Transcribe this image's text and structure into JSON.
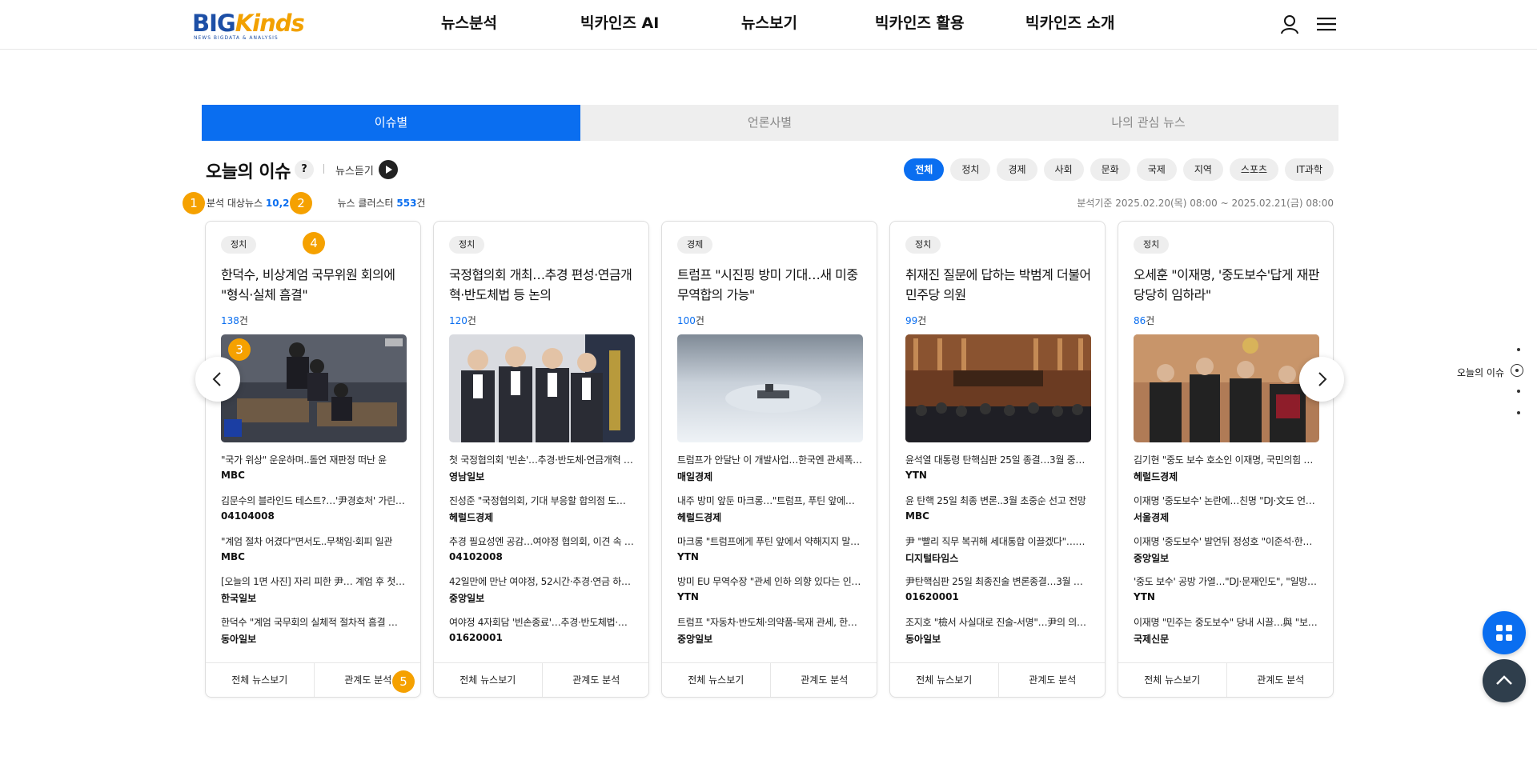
{
  "header": {
    "logo_main_big": "BIG",
    "logo_main_kinds": "Kinds",
    "logo_sub": "NEWS BIGDATA & ANALYSIS",
    "nav": [
      "뉴스분석",
      "빅카인즈 AI",
      "뉴스보기",
      "빅카인즈 활용",
      "빅카인즈 소개"
    ],
    "icons": [
      "user-icon",
      "menu-icon"
    ]
  },
  "tabs": [
    {
      "label": "이슈별",
      "active": true
    },
    {
      "label": "언론사별",
      "active": false
    },
    {
      "label": "나의 관심 뉴스",
      "active": false
    }
  ],
  "issue": {
    "title": "오늘의 이슈",
    "help": "?",
    "listen_label": "뉴스듣기",
    "categories": [
      "전체",
      "정치",
      "경제",
      "사회",
      "문화",
      "국제",
      "지역",
      "스포츠",
      "IT과학"
    ],
    "active_category": "전체",
    "stats": {
      "target_label": "분석 대상뉴스",
      "target_value": "10,21",
      "cluster_label": "뉴스 클러스터",
      "cluster_value": "553",
      "cluster_unit": "건"
    },
    "basis": "분석기준 2025.02.20(목) 08:00 ~ 2025.02.21(금) 08:00"
  },
  "markers": [
    "1",
    "2",
    "3",
    "4",
    "5"
  ],
  "cards": [
    {
      "category": "정치",
      "title": "한덕수, 비상계엄 국무위원 회의에 \"형식·실체 흠결\"",
      "count": "138",
      "unit": "건",
      "image": "courtroom-broadcast-photo",
      "news": [
        {
          "headline": "\"국가 위상\" 운운하며..돌연 재판정 떠난 윤",
          "source": "MBC"
        },
        {
          "headline": "김문수의 블라인드 테스트?…'尹경호처' 가린…",
          "source": "04104008"
        },
        {
          "headline": "\"계엄 절차 어겼다\"면서도..무책임·회피 일관",
          "source": "MBC"
        },
        {
          "headline": "[오늘의 1면 사진] 자리 피한 尹… 계엄 후 첫 …",
          "source": "한국일보"
        },
        {
          "headline": "한덕수 \"계엄 국무회의 실체적 절차적 흠결 …",
          "source": "동아일보"
        }
      ],
      "foot": [
        "전체 뉴스보기",
        "관계도 분석"
      ]
    },
    {
      "category": "정치",
      "title": "국정협의회 개최…추경 편성·연금개혁·반도체법 등 논의",
      "count": "120",
      "unit": "건",
      "image": "politicians-holding-hands-photo",
      "news": [
        {
          "headline": "첫 국정협의회 '빈손'…추경·반도체·연금개혁 …",
          "source": "영남일보"
        },
        {
          "headline": "진성준 \"국정협의회, 기대 부응할 합의점 도…",
          "source": "헤럴드경제"
        },
        {
          "headline": "추경 필요성엔 공감…여야정 협의회, 이견 속 …",
          "source": "04102008"
        },
        {
          "headline": "42일만에 만난 여야정, 52시간·추경·연금 하…",
          "source": "중앙일보"
        },
        {
          "headline": "여야정 4자회담 '빈손종료'…추경·반도체법·…",
          "source": "01620001"
        }
      ],
      "foot": [
        "전체 뉴스보기",
        "관계도 분석"
      ]
    },
    {
      "category": "경제",
      "title": "트럼프 \"시진핑 방미 기대…새 미중 무역합의 가능\"",
      "count": "100",
      "unit": "건",
      "image": "aerial-ice-island-photo",
      "news": [
        {
          "headline": "트럼프가 안달난 이 개발사업…한국엔 관세폭…",
          "source": "매일경제"
        },
        {
          "headline": "내주 방미 앞둔 마크롱…\"트럼프, 푸틴 앞에…",
          "source": "헤럴드경제"
        },
        {
          "headline": "마크롱 \"트럼프에게 푸틴 앞에서 약해지지 말…",
          "source": "YTN"
        },
        {
          "headline": "방미 EU 무역수장 \"관세 인하 의향 있다는 인…",
          "source": "YTN"
        },
        {
          "headline": "트럼프 \"자동차·반도체·의약품-목재 관세, 한…",
          "source": "중앙일보"
        }
      ],
      "foot": [
        "전체 뉴스보기",
        "관계도 분석"
      ]
    },
    {
      "category": "정치",
      "title": "취재진 질문에 답하는 박범계 더불어민주당 의원",
      "count": "99",
      "unit": "건",
      "image": "constitutional-court-photo",
      "news": [
        {
          "headline": "윤석열 대통령 탄핵심판 25일 종결…3월 중…",
          "source": "YTN"
        },
        {
          "headline": "윤 탄핵 25일 최종 변론..3월 초중순 선고 전망",
          "source": "MBC"
        },
        {
          "headline": "尹 \"빨리 직무 복귀해 세대통합 이끌겠다\"……",
          "source": "디지털타임스"
        },
        {
          "headline": "尹탄핵심판 25일 최종진술 변론종결…3월 …",
          "source": "01620001"
        },
        {
          "headline": "조지호 \"檢서 사실대로 진술-서명\"…尹의 의…",
          "source": "동아일보"
        }
      ],
      "foot": [
        "전체 뉴스보기",
        "관계도 분석"
      ]
    },
    {
      "category": "정치",
      "title": "오세훈 \"이재명, '중도보수'답게 재판 당당히 임하라\"",
      "count": "86",
      "unit": "건",
      "image": "politicians-meeting-photo",
      "news": [
        {
          "headline": "김기현 \"중도 보수 호소인 이재명, 국민의힘 …",
          "source": "헤럴드경제"
        },
        {
          "headline": "이재명 '중도보수' 논란에…친명 \"DJ·文도 언…",
          "source": "서울경제"
        },
        {
          "headline": "이재명 '중도보수' 발언뒤 정성호 \"이준석·한…",
          "source": "중앙일보"
        },
        {
          "headline": "'중도 보수' 공방 가열…\"DJ·문재인도\", \"일방 …",
          "source": "YTN"
        },
        {
          "headline": "이재명 \"민주는 중도보수\" 당내 시끌…與 \"보…",
          "source": "국제신문"
        }
      ],
      "foot": [
        "전체 뉴스보기",
        "관계도 분석"
      ]
    }
  ],
  "side_nav": {
    "label": "오늘의 이슈"
  },
  "colors": {
    "accent": "#0a6ef0",
    "marker": "#f5a100",
    "fab_dark": "#2f3e4c",
    "tab_bg": "#eeeeee"
  }
}
